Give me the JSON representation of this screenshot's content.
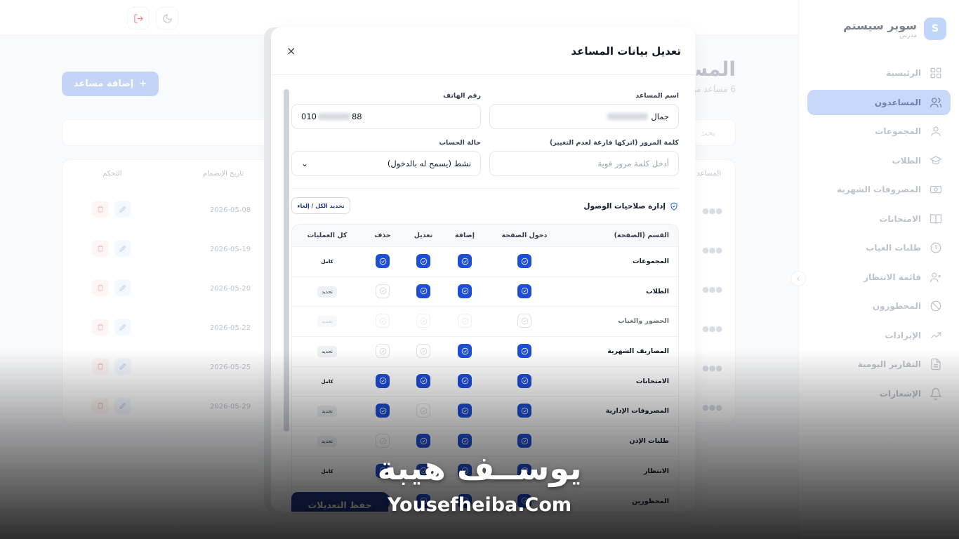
{
  "sidebar": {
    "brand_initial": "S",
    "brand_name": "سوبر سيستم",
    "brand_role": "مدرس",
    "items": [
      {
        "label": "الرئيسية",
        "icon": "grid-icon"
      },
      {
        "label": "المساعدون",
        "icon": "users-icon",
        "active": true
      },
      {
        "label": "المجموعات",
        "icon": "user-group-icon"
      },
      {
        "label": "الطلاب",
        "icon": "graduation-cap-icon"
      },
      {
        "label": "المصروفات الشهرية",
        "icon": "money-icon"
      },
      {
        "label": "الامتحانات",
        "icon": "book-icon"
      },
      {
        "label": "طلبات الغياب",
        "icon": "clock-icon"
      },
      {
        "label": "قائمة الانتظار",
        "icon": "user-x-icon"
      },
      {
        "label": "المحظورون",
        "icon": "ban-icon"
      },
      {
        "label": "الإيرادات",
        "icon": "trending-up-icon"
      },
      {
        "label": "التقارير اليومية",
        "icon": "file-text-icon"
      },
      {
        "label": "الإشعارات",
        "icon": "bell-icon"
      }
    ]
  },
  "page": {
    "title": "المساعدون",
    "subtitle": "6 مساعد مسجل",
    "add_button": "إضافة مساعد",
    "search_placeholder": "بحث",
    "columns": {
      "assistant": "المساعد",
      "join_date": "تاريخ الإنضمام",
      "control": "التحكم"
    },
    "rows": [
      {
        "date": "2026-05-08"
      },
      {
        "date": "2026-05-19"
      },
      {
        "date": "2026-05-20"
      },
      {
        "date": "2026-05-22"
      },
      {
        "date": "2026-05-25"
      },
      {
        "date": "2026-05-29"
      }
    ]
  },
  "modal": {
    "title": "تعديل بيانات المساعد",
    "close": "×",
    "name_label": "اسم المساعد",
    "name_value": "جمال",
    "phone_label": "رقم الهاتف",
    "phone_prefix": "010",
    "phone_suffix": "88",
    "password_label": "كلمة المرور (اتركها فارغة لعدم التغيير)",
    "password_placeholder": "أدخل كلمة مرور قوية",
    "status_label": "حالة الحساب",
    "status_value": "نشط (يسمح له بالدخول)",
    "permissions_title": "إدارة صلاحيات الوصول",
    "toggle_all": "تحديد الكل / إلغاء",
    "perm_headers": {
      "section": "القسم (الصفحة)",
      "access": "دخول الصفحة",
      "add": "إضافة",
      "edit": "تعديل",
      "delete": "حذف",
      "all": "كل العمليات"
    },
    "permissions": [
      {
        "name": "المجموعات",
        "state": "full",
        "btn": "كامل",
        "access": "on",
        "add": "on",
        "edit": "on",
        "delete": "on"
      },
      {
        "name": "الطلاب",
        "state": "partial",
        "btn": "تحديد",
        "access": "on",
        "add": "on",
        "edit": "on",
        "delete": "off"
      },
      {
        "name": "الحضور والغياب",
        "state": "disabled",
        "btn": "تحديد",
        "access": "off",
        "add": "dis",
        "edit": "dis",
        "delete": "dis"
      },
      {
        "name": "المصاريف الشهرية",
        "state": "partial",
        "btn": "تحديد",
        "access": "on",
        "add": "on",
        "edit": "off",
        "delete": "off"
      },
      {
        "name": "الامتحانات",
        "state": "full",
        "btn": "كامل",
        "access": "on",
        "add": "on",
        "edit": "on",
        "delete": "on"
      },
      {
        "name": "المصروفات الإدارية",
        "state": "partial",
        "btn": "تحديد",
        "access": "on",
        "add": "on",
        "edit": "off",
        "delete": "on"
      },
      {
        "name": "طلبات الإذن",
        "state": "partial",
        "btn": "تحديد",
        "access": "on",
        "add": "on",
        "edit": "on",
        "delete": "off"
      },
      {
        "name": "الانتظار",
        "state": "full",
        "btn": "كامل",
        "access": "on",
        "add": "on",
        "edit": "on",
        "delete": "on"
      },
      {
        "name": "المحظورين",
        "state": "full",
        "btn": "كامل",
        "access": "on",
        "add": "on",
        "edit": "on",
        "delete": "on"
      }
    ],
    "save_button": "حفظ التعديلات"
  },
  "watermark": {
    "arabic": "يوســف هيبة",
    "english": "Yousefheiba.Com"
  },
  "colors": {
    "primary": "#1d4ed8",
    "sidebar_active": "#a9c3f5",
    "danger": "#f87171"
  }
}
